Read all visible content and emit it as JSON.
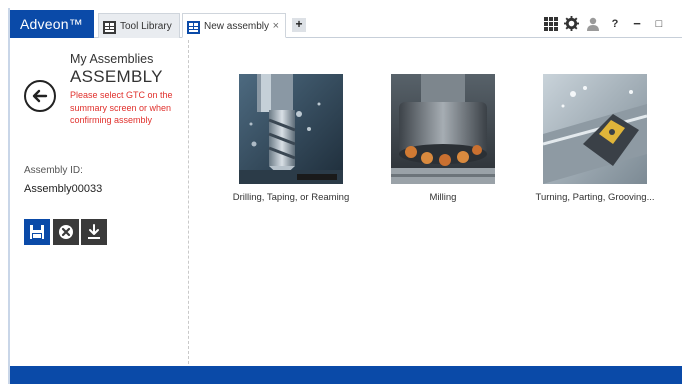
{
  "app": {
    "brand": "Adveon™"
  },
  "tabs": [
    {
      "label": "Tool Library",
      "icon": "grid-table-icon",
      "active": false
    },
    {
      "label": "New assembly",
      "icon": "grid-table-icon",
      "active": true,
      "close": "×"
    }
  ],
  "tab_add": "+",
  "titlebar_buttons": {
    "apps": "apps-grid-icon",
    "settings": "gear-icon",
    "user": "user-icon",
    "help": "?",
    "minimize": "−",
    "maximize": "□"
  },
  "left": {
    "heading": "My Assemblies",
    "title": "ASSEMBLY",
    "warning": "Please select GTC on the summary screen or when confirming assembly",
    "id_label": "Assembly ID:",
    "id_value": "Assembly00033"
  },
  "cards": [
    {
      "caption": "Drilling, Taping, or Reaming"
    },
    {
      "caption": "Milling"
    },
    {
      "caption": "Turning, Parting, Grooving..."
    }
  ],
  "colors": {
    "brand": "#0a4aa8",
    "warning": "#e0302c",
    "dark_button": "#3a3a3a"
  }
}
